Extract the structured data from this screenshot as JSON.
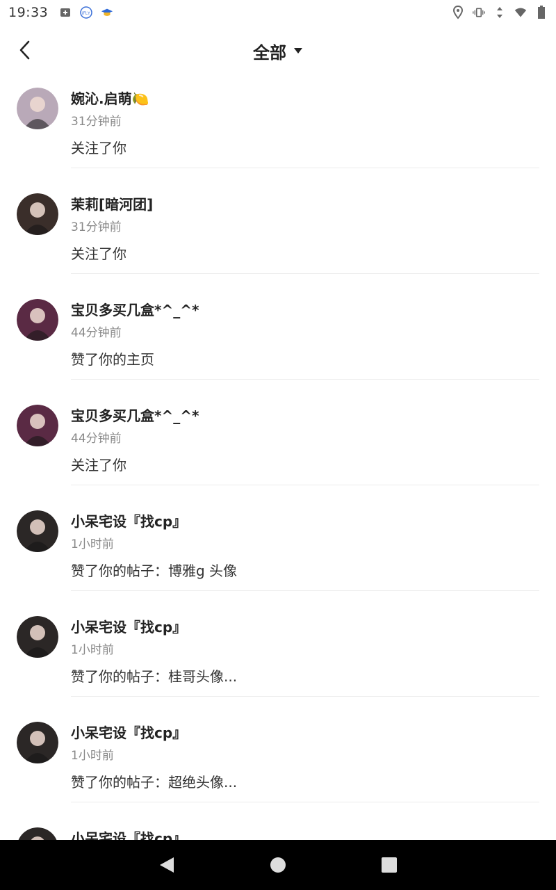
{
  "status_bar": {
    "time": "19:33",
    "left_icons": [
      "plus-square-icon",
      "iflytek-icon",
      "graduation-cap-icon"
    ],
    "right_icons": [
      "location-icon",
      "vibrate-icon",
      "data-arrows-icon",
      "wifi-icon",
      "battery-icon"
    ]
  },
  "header": {
    "title": "全部",
    "back_icon": "chevron-left-icon",
    "dropdown_icon": "caret-down-icon"
  },
  "notifications": [
    {
      "name": "婉沁.启萌🍋",
      "time": "31分钟前",
      "action": "关注了你",
      "avatar_color": "#b9a9b8"
    },
    {
      "name": "茉莉[暗河团]",
      "time": "31分钟前",
      "action": "关注了你",
      "avatar_color": "#3a2e2a"
    },
    {
      "name": "宝贝多买几盒*^_^*",
      "time": "44分钟前",
      "action": "赞了你的主页",
      "avatar_color": "#5a2a44"
    },
    {
      "name": "宝贝多买几盒*^_^*",
      "time": "44分钟前",
      "action": "关注了你",
      "avatar_color": "#5a2a44"
    },
    {
      "name": "小呆宅设『找cp』",
      "time": "1小时前",
      "action": "赞了你的帖子：博雅g 头像",
      "avatar_color": "#2b2726"
    },
    {
      "name": "小呆宅设『找cp』",
      "time": "1小时前",
      "action": "赞了你的帖子：桂哥头像...",
      "avatar_color": "#2b2726"
    },
    {
      "name": "小呆宅设『找cp』",
      "time": "1小时前",
      "action": "赞了你的帖子：超绝头像...",
      "avatar_color": "#2b2726"
    },
    {
      "name": "小呆宅设『找cp』",
      "time": "",
      "action": "",
      "avatar_color": "#2b2726"
    }
  ],
  "nav_bar": {
    "back_icon": "triangle-back-icon",
    "home_icon": "circle-home-icon",
    "recents_icon": "square-recents-icon"
  }
}
